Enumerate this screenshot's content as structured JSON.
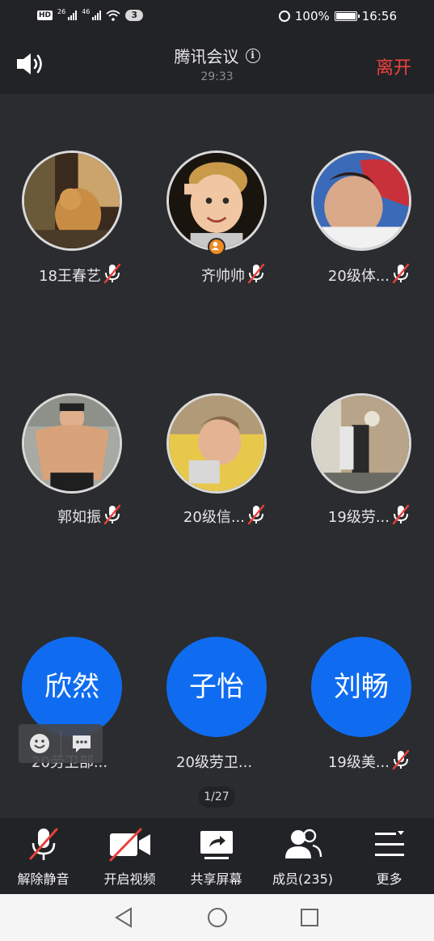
{
  "status_bar": {
    "hd_label": "HD",
    "hd_sub": "2",
    "net1": "26",
    "net2": "46",
    "badge": "3",
    "battery": "100%",
    "time": "16:56"
  },
  "header": {
    "title": "腾讯会议",
    "info_icon": "i",
    "timer": "29:33",
    "leave_label": "离开"
  },
  "participants": [
    {
      "name": "18王春艺",
      "muted": true,
      "avatar": "photo"
    },
    {
      "name": "齐帅帅",
      "muted": true,
      "avatar": "photo",
      "host": true
    },
    {
      "name": "20级体...",
      "muted": true,
      "avatar": "photo"
    },
    {
      "name": "郭如振",
      "muted": true,
      "avatar": "photo"
    },
    {
      "name": "20级信...",
      "muted": true,
      "avatar": "photo"
    },
    {
      "name": "19级劳...",
      "muted": true,
      "avatar": "photo"
    },
    {
      "name": "20劳卫部...",
      "muted": false,
      "avatar_text": "欣然"
    },
    {
      "name": "20级劳卫...",
      "muted": false,
      "avatar_text": "子怡"
    },
    {
      "name": "19级美...",
      "muted": true,
      "avatar_text": "刘畅"
    }
  ],
  "page_indicator": "1/27",
  "toolbar": {
    "unmute_label": "解除静音",
    "video_label": "开启视频",
    "share_label": "共享屏幕",
    "members_label": "成员(235)",
    "more_label": "更多"
  },
  "colors": {
    "background": "#2b2c2f",
    "bar": "#222326",
    "accent_blue": "#0f6cf0",
    "leave_red": "#f0413d",
    "mute_red": "#e8413c",
    "host_orange": "#f08a24"
  }
}
